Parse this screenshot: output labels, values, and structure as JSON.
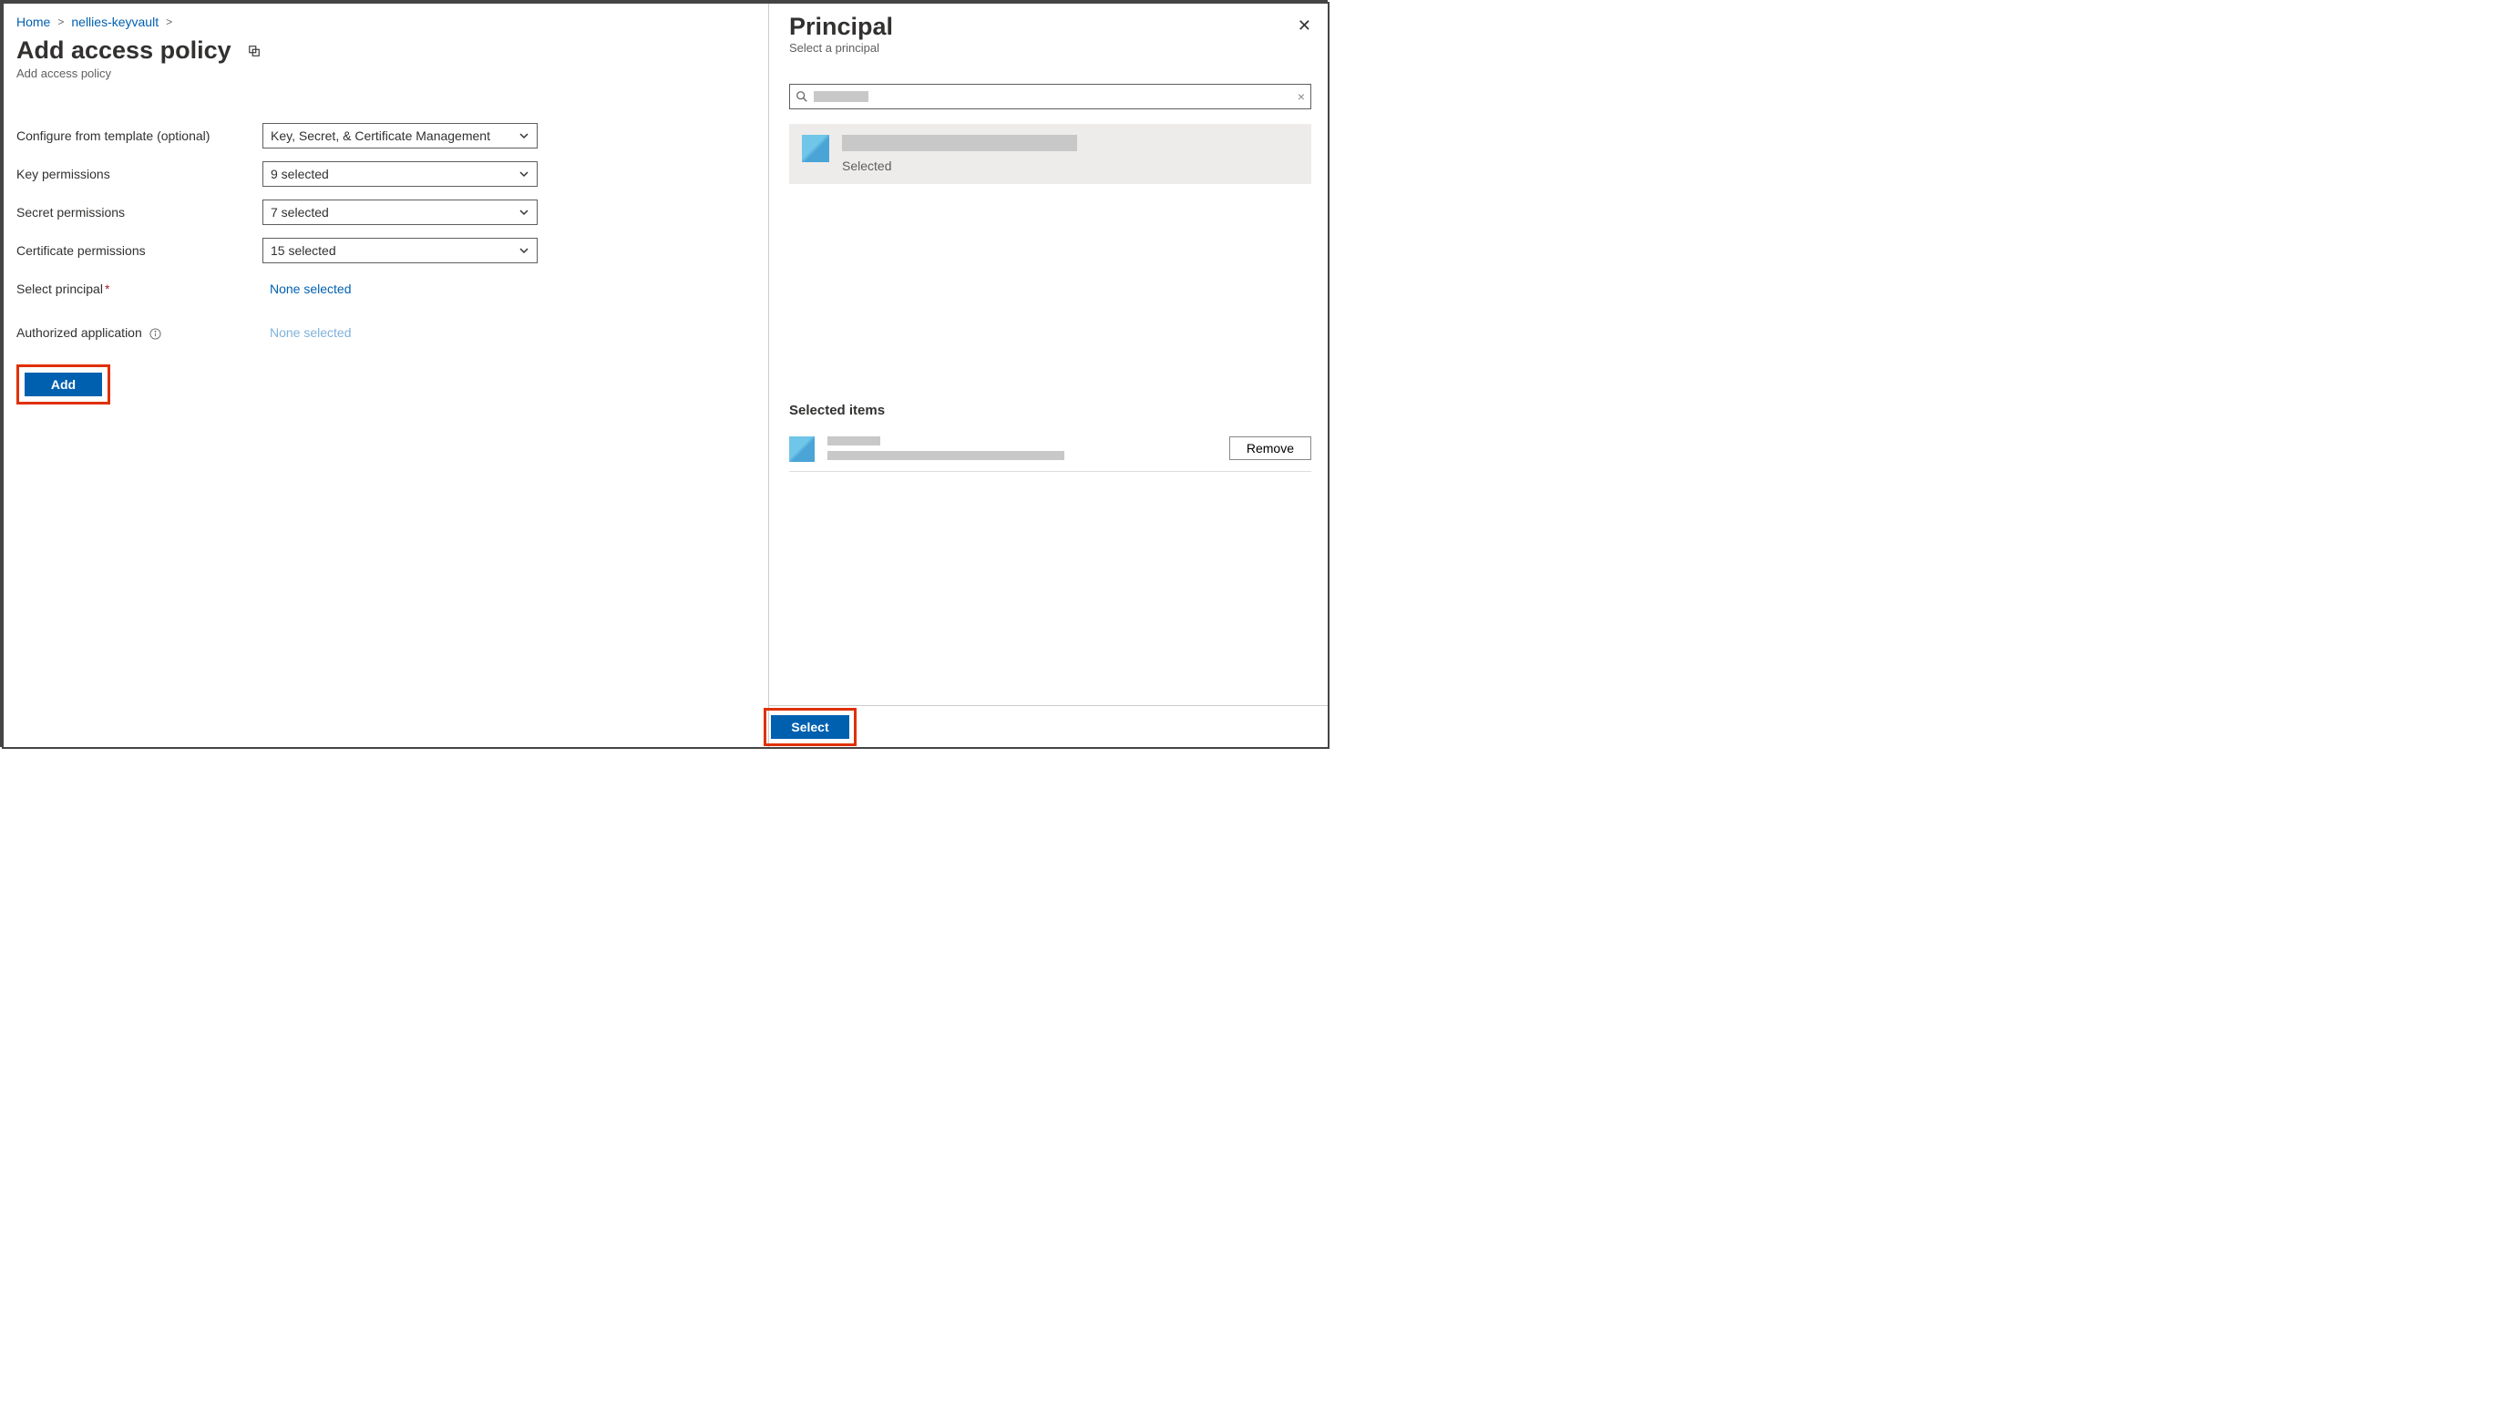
{
  "breadcrumb": {
    "home": "Home",
    "vault": "nellies-keyvault"
  },
  "page": {
    "title": "Add access policy",
    "subtitle": "Add access policy"
  },
  "form": {
    "template_label": "Configure from template (optional)",
    "template_value": "Key, Secret, & Certificate Management",
    "key_label": "Key permissions",
    "key_value": "9 selected",
    "secret_label": "Secret permissions",
    "secret_value": "7 selected",
    "cert_label": "Certificate permissions",
    "cert_value": "15 selected",
    "principal_label": "Select principal",
    "principal_value": "None selected",
    "app_label": "Authorized application",
    "app_value": "None selected",
    "add_btn": "Add"
  },
  "panel": {
    "title": "Principal",
    "subtitle": "Select a principal",
    "search_placeholder": "",
    "result_status": "Selected",
    "selected_heading": "Selected items",
    "remove_btn": "Remove",
    "select_btn": "Select"
  }
}
